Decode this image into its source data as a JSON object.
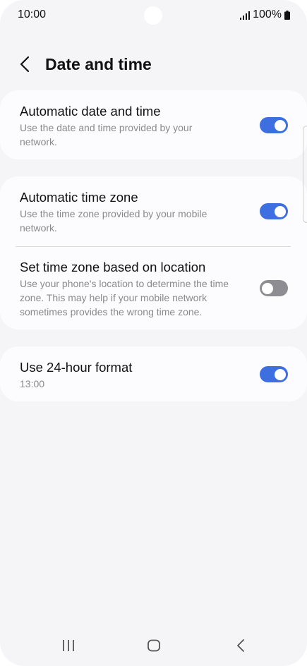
{
  "status_bar": {
    "time": "10:00",
    "battery": "100%",
    "icons": [
      "signal-icon",
      "battery-icon"
    ]
  },
  "header": {
    "title": "Date and time",
    "back_icon": "back-icon"
  },
  "settings": {
    "automatic_date_time": {
      "title": "Automatic date and time",
      "description": "Use the date and time provided by your network.",
      "enabled": true
    },
    "automatic_time_zone": {
      "title": "Automatic time zone",
      "description": "Use the time zone provided by your mobile network.",
      "enabled": true
    },
    "time_zone_location": {
      "title": "Set time zone based on location",
      "description": "Use your phone's location to determine the time zone. This may help if your mobile network sometimes provides the wrong time zone.",
      "enabled": false
    },
    "use_24_hour": {
      "title": "Use 24-hour format",
      "description": "13:00",
      "enabled": true
    }
  },
  "nav_bar": {
    "icons": [
      "recents-icon",
      "home-icon",
      "back-icon"
    ]
  },
  "colors": {
    "accent": "#3e6fe0",
    "background": "#f5f5f7",
    "card": "#fcfcfe",
    "toggle_off": "#8e8e92",
    "secondary_text": "#8a8a8e"
  }
}
